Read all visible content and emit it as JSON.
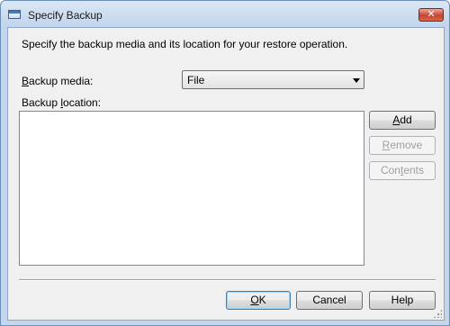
{
  "window": {
    "title": "Specify Backup",
    "close_glyph": "✕"
  },
  "description": "Specify the backup media and its location for your restore operation.",
  "backup_media": {
    "label_accel": "B",
    "label_rest": "ackup media:",
    "selected": "File"
  },
  "backup_location": {
    "label_pre": "Backup ",
    "label_accel": "l",
    "label_rest": "ocation:",
    "items": []
  },
  "side_buttons": {
    "add": {
      "accel": "A",
      "rest": "dd",
      "enabled": true
    },
    "remove": {
      "accel": "R",
      "rest": "emove",
      "enabled": false
    },
    "contents": {
      "pre": "Con",
      "accel": "t",
      "rest": "ents",
      "enabled": false
    }
  },
  "footer_buttons": {
    "ok": {
      "accel": "O",
      "rest": "K"
    },
    "cancel": "Cancel",
    "help": "Help"
  },
  "icons": {
    "window_icon": "window-icon",
    "close": "close-icon",
    "dropdown": "chevron-down-icon",
    "resize": "resize-grip-icon"
  }
}
